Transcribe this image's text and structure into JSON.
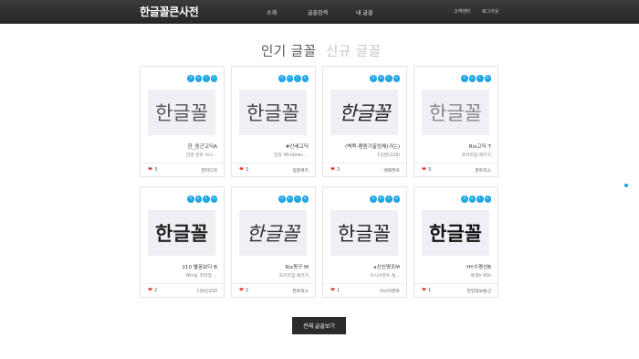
{
  "header": {
    "brand": "한글꼴큰사전",
    "nav": [
      "소개",
      "글꼴검색",
      "내 글꼴"
    ],
    "utility": [
      "고객센터",
      "로그아웃"
    ]
  },
  "tabs": {
    "popular": "인기 글꼴",
    "new": "신규 글꼴"
  },
  "badge_letters": [
    "가",
    "A",
    "1",
    "&"
  ],
  "preview_text": "한글꼴",
  "cards": [
    {
      "name": "한_둥근고딕A",
      "desc": "한글 폰트 아스...",
      "likes": "3",
      "maker": "한터디자"
    },
    {
      "name": "#산세고딕",
      "desc": "한창 Windows ...",
      "likes": "3",
      "maker": "정운메카"
    },
    {
      "name": "(백묵-팬돔기출링체(가는)",
      "desc": "1장편(228)",
      "likes": "3",
      "maker": "백묵폰트"
    },
    {
      "name": "Rix고딕 T",
      "desc": "프리미엄 패키지",
      "likes": "3",
      "maker": "폰트릭스"
    },
    {
      "name": "210 별꿈보다 B",
      "desc": "Win용 359형 ...",
      "likes": "2",
      "maker": "디자인210"
    },
    {
      "name": "Rix펑구 M",
      "desc": "프리미엄 패키지",
      "likes": "2",
      "maker": "폰트릭스"
    },
    {
      "name": "a신신명조M",
      "desc": "아시아폰트 통...",
      "likes": "1",
      "maker": "아시아폰트"
    },
    {
      "name": "HY수평선B",
      "desc": "특형b Win",
      "likes": "1",
      "maker": "한양정보통신"
    }
  ],
  "view_all": "전체 글꼴보기",
  "colors": {
    "header_bg": "#2e2e2e",
    "badge": "#1ea6e6",
    "heart": "#e3342f",
    "button_bg": "#2b2b2b"
  }
}
